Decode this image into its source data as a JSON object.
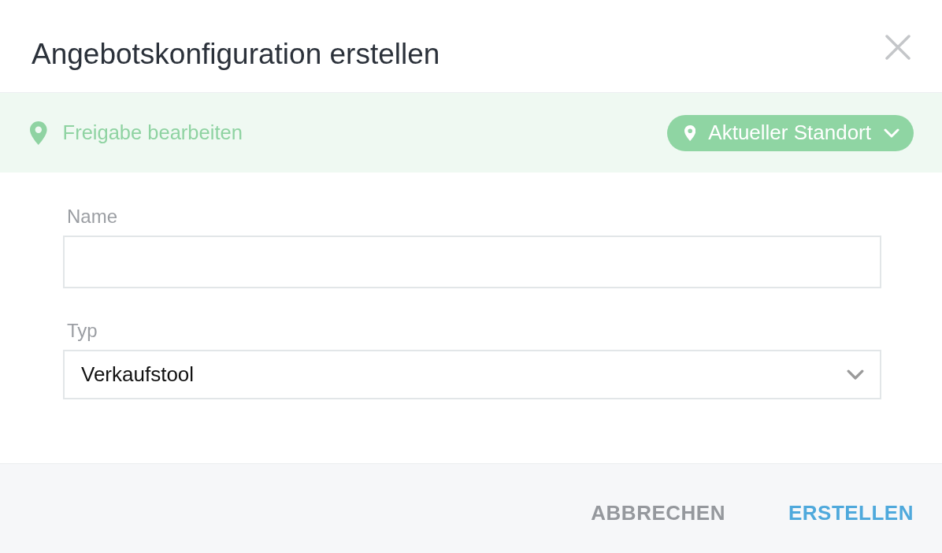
{
  "dialog": {
    "title": "Angebotskonfiguration erstellen",
    "sharing_bar": {
      "label": "Freigabe bearbeiten",
      "location_button": "Aktueller Standort"
    },
    "fields": [
      {
        "kind": "text",
        "label": "Name"
      },
      {
        "kind": "select",
        "label": "Typ",
        "value": "Verkaufstool"
      }
    ],
    "buttons": [
      {
        "label": "ABBRECHEN",
        "kind": "secondary"
      },
      {
        "label": "ERSTELLEN",
        "kind": "primary"
      }
    ]
  }
}
